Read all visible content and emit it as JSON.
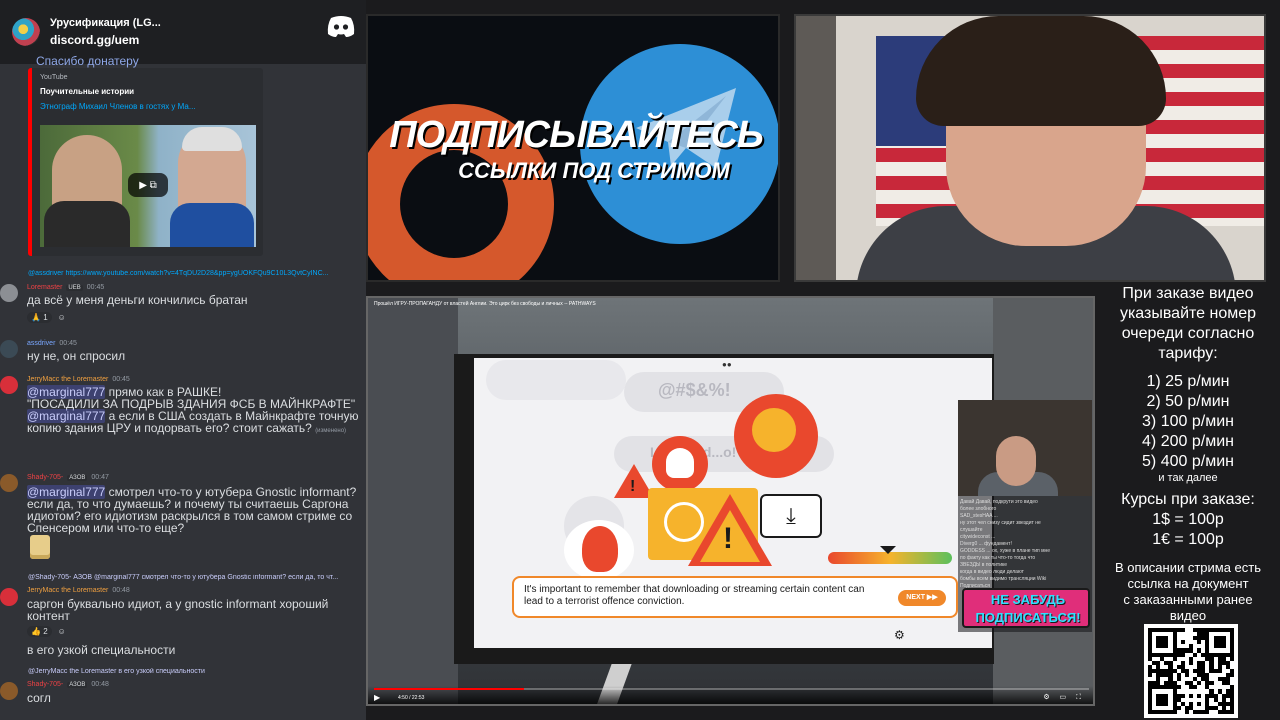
{
  "discord": {
    "server_name": "Урусификация (LG...",
    "invite": "discord.gg/uem",
    "partial_top_text": "Спасибо донатеру",
    "embed": {
      "provider": "YouTube",
      "author": "Поучительные истории",
      "title": "Этнограф Михаил Членов в гостях у Ма..."
    },
    "messages": [
      {
        "reply": "@assdriver https://www.youtube.com/watch?v=4TqDU2D28&pp=ygUOKFQu9C10L3QvtCyINC...",
        "user": "Loremaster",
        "badge": "UEB",
        "time": "00:45",
        "text": "да всё у меня деньги кончились братан",
        "reactions": [
          "1"
        ]
      },
      {
        "user": "assdriver",
        "time": "00:45",
        "text": "ну не, он спросил"
      },
      {
        "user": "JerryMacc the Loremaster",
        "time": "00:45",
        "mention1": "@marginal777",
        "line1": " прямо как в РАШКЕ!",
        "line2": "\"ПОСАДИЛИ ЗА ПОДРЫВ ЗДАНИЯ ФСБ В МАЙНКРАФТЕ\"",
        "mention2": "@marginal777",
        "line3": " а если в США создать в Майнкрафте точную копию здания ЦРУ и подорвать его? стоит сажать?",
        "edited": "(изменено)"
      },
      {
        "user": "Shady-705-",
        "badge": "АЗОВ",
        "time": "00:47",
        "mention": "@marginal777",
        "text": " смотрел что-то у ютубера Gnostic informant? если да, то что думаешь? и почему ты считаешь Саргона идиотом? его идиотизм раскрылся в том самом стриме со Спенсером или что-то еще?"
      },
      {
        "reply": "@Shady-705-  АЗОВ  @marginal777 смотрел что-то у ютубера Gnostic informant? если да, то чт...",
        "user": "JerryMacc the Loremaster",
        "time": "00:48",
        "text": "саргон буквально идиот, а у gnostic informant хороший контент",
        "reactions": [
          "2"
        ]
      },
      {
        "text": "в его узкой специальности"
      },
      {
        "reply": "@JerryMacc the Loremaster в его узкой специальности",
        "user": "Shady-705-",
        "badge": "АЗОВ",
        "time": "00:48",
        "text": "согл"
      }
    ]
  },
  "banner": {
    "headline": "ПОДПИСЫВАЙТЕСЬ",
    "subheadline": "ССЫЛКИ ПОД СТРИМОМ"
  },
  "player": {
    "video_title": "Прошёл ИГРУ-ПРОПАГАНДУ от властей Англии. Это цирк без свободы и личных -- PATHWAYS",
    "bubble_text_1": "@#$&%!",
    "bubble_text_2": "L...nlo...d...o!",
    "dialog_text": "It's important to remember that downloading or streaming certain content can lead to a terrorist offence conviction.",
    "next_label": "NEXT",
    "sticker_line1": "НЕ ЗАБУДЬ",
    "sticker_line2": "ПОДПИСАТЬСЯ!",
    "time": "4:50 / 22:53",
    "progress": 0.21,
    "overlay_chat": [
      "Давай Давай, подкрути это видео",
      "более злобного",
      "SAD_stesHAA ...",
      "ну этот чел снизу сидит звездит не",
      "слушайте",
      "citywideconst ...",
      "Diverg0 ... фундамент!",
      "GODDESS ... ох, хуже в плане тип мне",
      "по факту как ты что-то тогда что",
      "ЗВЕЗДЫ в политике",
      "когда в видео люди делают",
      "бомбы всем видимо трансляции Wiki",
      "Подписаться"
    ]
  },
  "info": {
    "order_lines": [
      "При заказе видео",
      "указывайте номер",
      "очереди согласно",
      "тарифу:"
    ],
    "rates": [
      "1) 25 р/мин",
      "2) 50 р/мин",
      "3) 100 р/мин",
      "4) 200 р/мин",
      "5) 400 р/мин"
    ],
    "rates_more": "и так далее",
    "courses_title": "Курсы при заказе:",
    "courses": [
      "1$ = 100р",
      "1€ = 100р"
    ],
    "desc_lines": [
      "В описании стрима есть",
      "ссылка на документ",
      "с заказанными ранее",
      "видео"
    ]
  },
  "colors": {
    "discord_bg": "#313338",
    "discord_dark": "#1e1f22",
    "mention": "#c9cdfb",
    "warning_orange": "#f0882a",
    "alert_red": "#e9482d",
    "telegram_blue": "#2d8fd6"
  }
}
